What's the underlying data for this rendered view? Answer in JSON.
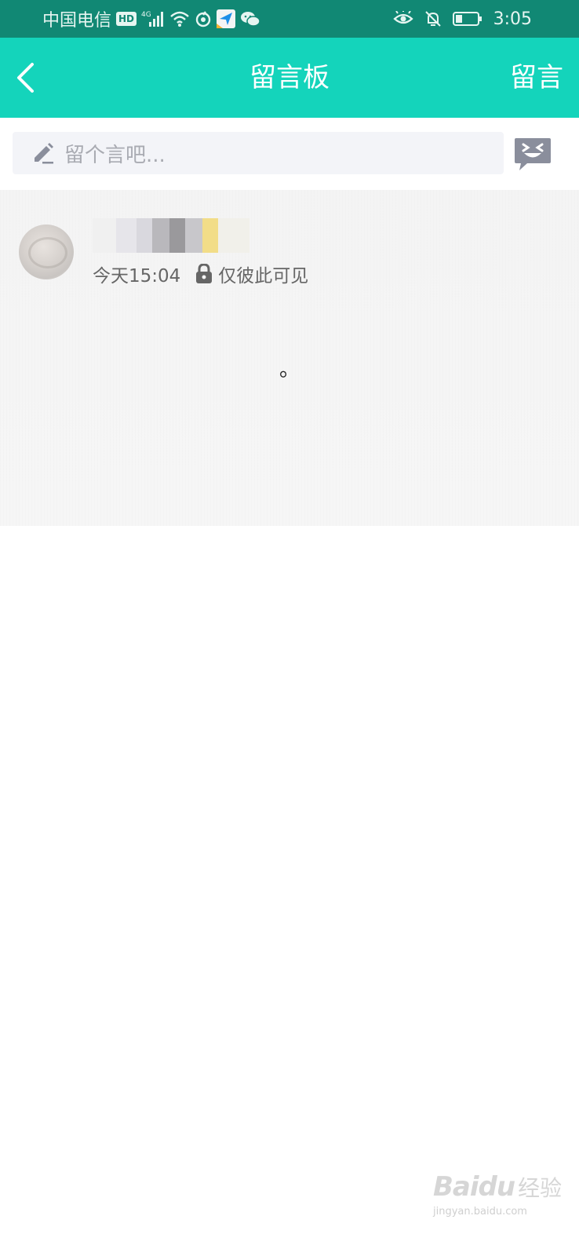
{
  "status_bar": {
    "carrier": "中国电信",
    "hd_badge": "HD",
    "network": "4G",
    "time": "3:05"
  },
  "app_bar": {
    "title": "留言板",
    "post_label": "留言"
  },
  "compose": {
    "placeholder": "留个言吧..."
  },
  "message": {
    "time": "今天15:04",
    "visibility": "仅彼此可见",
    "text": "。"
  },
  "watermark": {
    "logo": "Baidu",
    "suffix": "经验",
    "url": "jingyan.baidu.com"
  },
  "colors": {
    "status_bar": "#118874",
    "app_bar": "#14d4bb",
    "compose_bg": "#f3f4f8",
    "emoji_icon": "#8a8e9c"
  }
}
